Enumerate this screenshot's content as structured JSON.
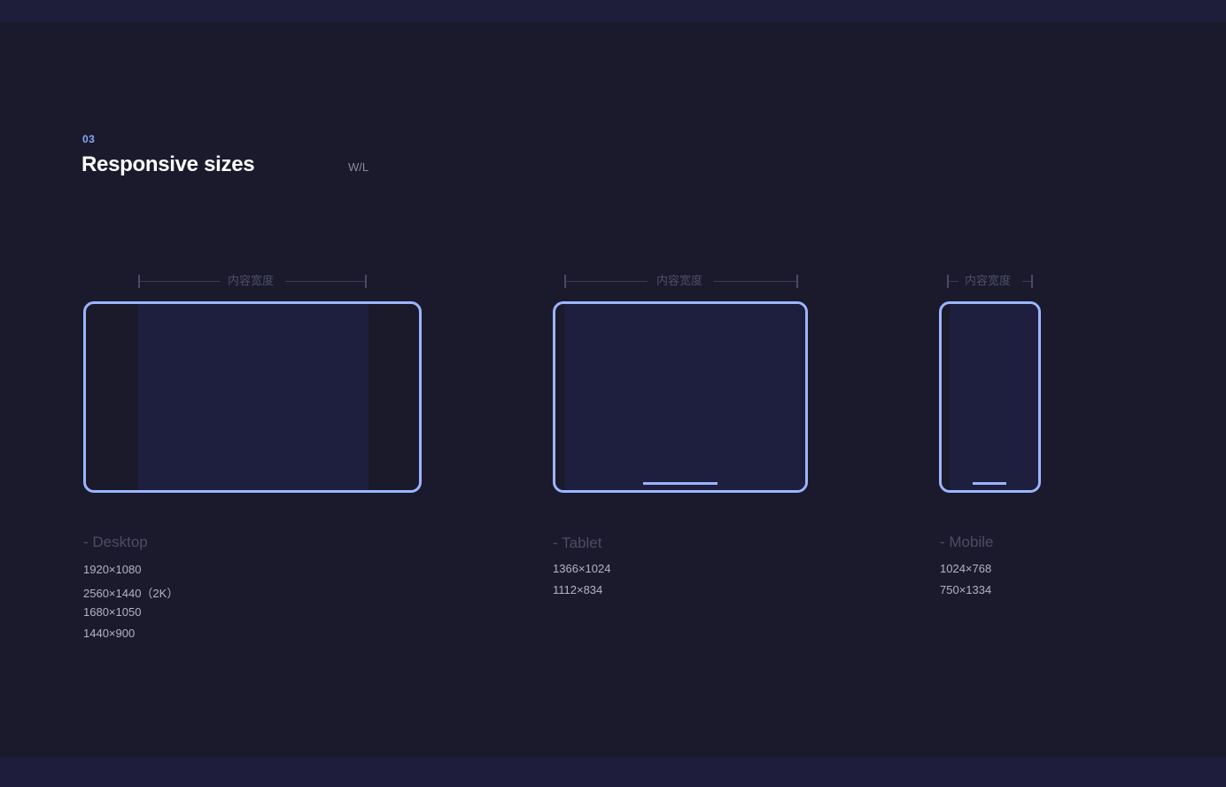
{
  "section": {
    "number": "03",
    "title": "Responsive sizes",
    "tag": "W/L"
  },
  "measure_label": "内容宽度",
  "accent_color": "#9bb5ff",
  "devices": [
    {
      "name": "- Desktop",
      "sizes": [
        "1920×1080",
        "2560×1440（2K）",
        "1680×1050",
        "1440×900"
      ]
    },
    {
      "name": "- Tablet",
      "sizes": [
        "1366×1024",
        "1112×834"
      ]
    },
    {
      "name": "- Mobile",
      "sizes": [
        "1024×768",
        "750×1334"
      ]
    }
  ]
}
